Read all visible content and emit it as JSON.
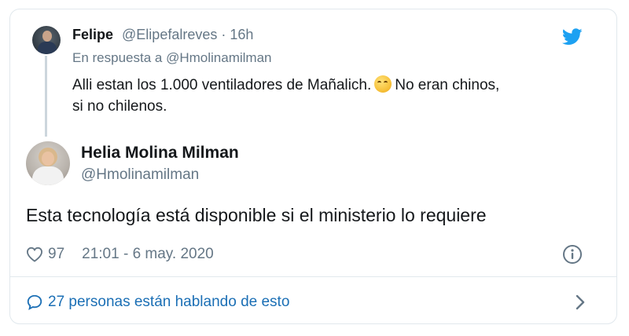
{
  "reply": {
    "name": "Felipe",
    "handle_time": "@Elipefalreves · 16h",
    "reply_prefix": "En respuesta a",
    "reply_mention": "@Hmolinamilman",
    "text_part1": "Alli estan los 1.000 ventiladores de Mañalich.",
    "text_part2": "No eran chinos,",
    "text_line2": "si no chilenos."
  },
  "main": {
    "name": "Helia Molina Milman",
    "handle": "@Hmolinamilman",
    "text": "Esta tecnología está disponible si el ministerio lo requiere",
    "likes": "97",
    "timestamp": "21:01 - 6 may. 2020"
  },
  "footer": {
    "conversation": "27 personas están hablando de esto"
  },
  "icons": {
    "bird": "twitter-bird-icon",
    "heart": "heart-icon",
    "info": "info-icon",
    "bubble": "speech-bubble-icon",
    "chevron": "chevron-right-icon",
    "emoji": "rolling-laughing-emoji"
  },
  "colors": {
    "twitter_blue": "#1da1f2",
    "link_blue": "#1b6fb5",
    "muted": "#657786",
    "text": "#14171a",
    "border": "#e1e8ed"
  }
}
